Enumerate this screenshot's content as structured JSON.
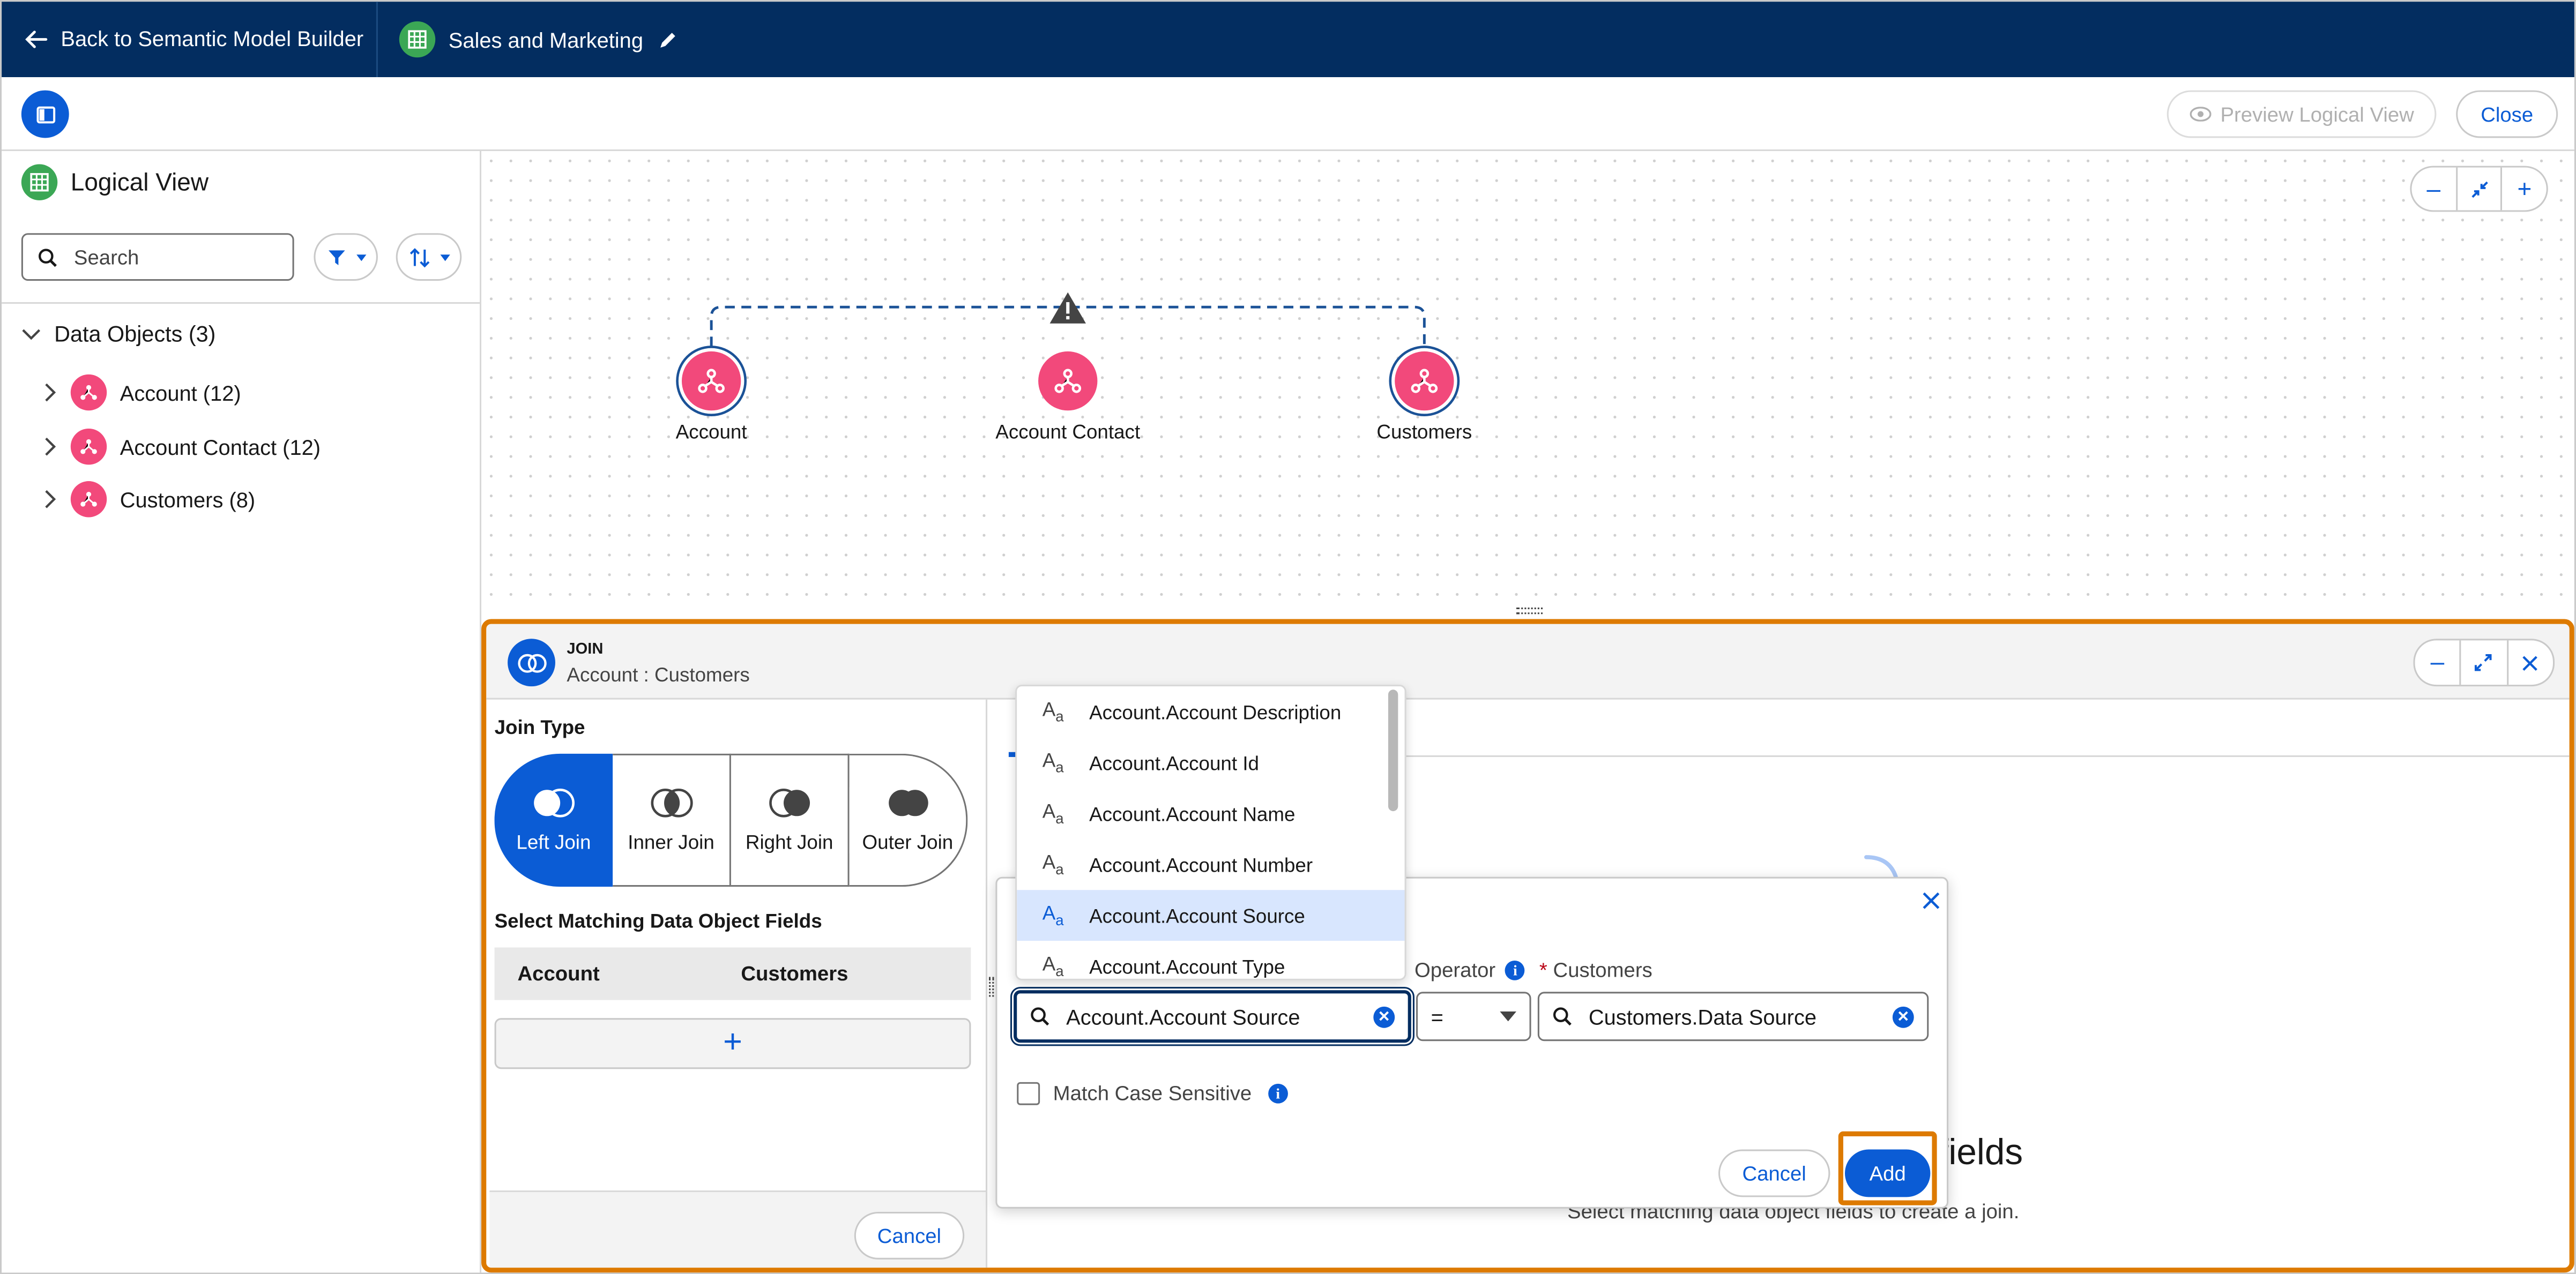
{
  "topbar": {
    "back_label": "Back to Semantic Model Builder",
    "model_name": "Sales and Marketing"
  },
  "toolbar": {
    "preview_label": "Preview Logical View",
    "close_label": "Close"
  },
  "sidebar": {
    "title": "Logical View",
    "search_placeholder": "Search",
    "section_label": "Data Objects (3)",
    "items": [
      {
        "label": "Account (12)"
      },
      {
        "label": "Account Contact (12)"
      },
      {
        "label": "Customers (8)"
      }
    ]
  },
  "canvas": {
    "nodes": [
      {
        "label": "Account"
      },
      {
        "label": "Account Contact"
      },
      {
        "label": "Customers"
      }
    ]
  },
  "join": {
    "kicker": "JOIN",
    "subtitle": "Account : Customers",
    "join_type_label": "Join Type",
    "join_types": [
      {
        "label": "Left Join",
        "selected": true
      },
      {
        "label": "Inner Join",
        "selected": false
      },
      {
        "label": "Right Join",
        "selected": false
      },
      {
        "label": "Outer Join",
        "selected": false
      }
    ],
    "matching_label": "Select Matching Data Object Fields",
    "col_left": "Account",
    "col_right": "Customers",
    "add_symbol": "+",
    "cancel_label": "Cancel",
    "empty_title_fragment": "fields",
    "empty_sub_fragment": "Select matching data object fields to create a join."
  },
  "dropdown": {
    "icon_text": "A",
    "icon_sub": "a",
    "options": [
      {
        "label": "Account.Account Description",
        "highlighted": false
      },
      {
        "label": "Account.Account Id",
        "highlighted": false
      },
      {
        "label": "Account.Account Name",
        "highlighted": false
      },
      {
        "label": "Account.Account Number",
        "highlighted": false
      },
      {
        "label": "Account.Account Source",
        "highlighted": true
      },
      {
        "label": "Account.Account Type",
        "highlighted": false
      }
    ]
  },
  "modal": {
    "operator_label": "Operator",
    "required_mark": "*",
    "right_label": "Customers",
    "left_value": "Account.Account Source",
    "operator_value": "=",
    "right_value": "Customers.Data Source",
    "case_label": "Match Case Sensitive",
    "cancel_label": "Cancel",
    "add_label": "Add"
  },
  "colors": {
    "brand_navy": "#032d60",
    "brand_blue": "#0b5cd5",
    "node_pink": "#f2497b",
    "highlight_orange": "#dd7a01",
    "warning_gray": "#444444"
  }
}
